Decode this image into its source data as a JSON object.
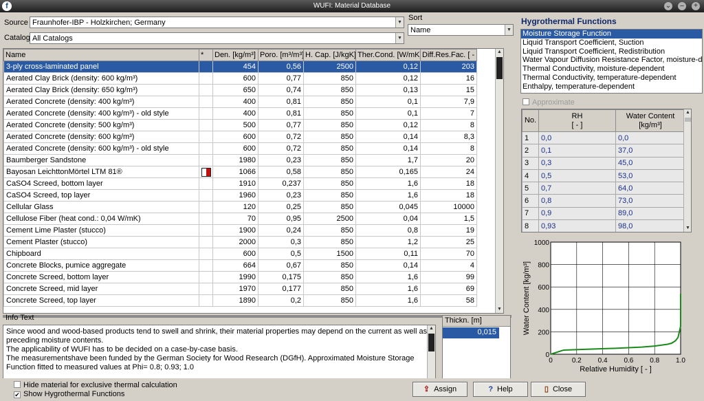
{
  "window": {
    "title": "WUFI: Material Database"
  },
  "source": {
    "label": "Source",
    "value": "Fraunhofer-IBP - Holzkirchen; Germany"
  },
  "catalog": {
    "label": "Catalog",
    "value": "All Catalogs"
  },
  "sort": {
    "label": "Sort",
    "value": "Name"
  },
  "materials": {
    "columns": [
      "Name",
      "*",
      "Den. [kg/m³]",
      "Poro. [m³/m³]",
      "H. Cap. [J/kgK]",
      "Ther.Cond. [W/mK]",
      "Diff.Res.Fac. [ - ]"
    ],
    "rows": [
      [
        "3-ply cross-laminated panel",
        "",
        "454",
        "0,56",
        "2500",
        "0,12",
        "203"
      ],
      [
        "Aerated Clay Brick (density: 600 kg/m³)",
        "",
        "600",
        "0,77",
        "850",
        "0,12",
        "16"
      ],
      [
        "Aerated Clay Brick (density: 650 kg/m³)",
        "",
        "650",
        "0,74",
        "850",
        "0,13",
        "15"
      ],
      [
        "Aerated Concrete (density: 400 kg/m³)",
        "",
        "400",
        "0,81",
        "850",
        "0,1",
        "7,9"
      ],
      [
        "Aerated Concrete (density: 400 kg/m³) - old style",
        "",
        "400",
        "0,81",
        "850",
        "0,1",
        "7"
      ],
      [
        "Aerated Concrete (density: 500 kg/m³)",
        "",
        "500",
        "0,77",
        "850",
        "0,12",
        "8"
      ],
      [
        "Aerated Concrete (density: 600 kg/m³)",
        "",
        "600",
        "0,72",
        "850",
        "0,14",
        "8,3"
      ],
      [
        "Aerated Concrete (density: 600 kg/m³) - old style",
        "",
        "600",
        "0,72",
        "850",
        "0,14",
        "8"
      ],
      [
        "Baumberger Sandstone",
        "",
        "1980",
        "0,23",
        "850",
        "1,7",
        "20"
      ],
      [
        "Bayosan LeichttonMörtel LTM 81®",
        "logo",
        "1066",
        "0,58",
        "850",
        "0,165",
        "24"
      ],
      [
        "CaSO4 Screed, bottom layer",
        "",
        "1910",
        "0,237",
        "850",
        "1,6",
        "18"
      ],
      [
        "CaSO4 Screed, top layer",
        "",
        "1960",
        "0,23",
        "850",
        "1,6",
        "18"
      ],
      [
        "Cellular Glass",
        "",
        "120",
        "0,25",
        "850",
        "0,045",
        "10000"
      ],
      [
        "Cellulose Fiber (heat cond.: 0,04 W/mK)",
        "",
        "70",
        "0,95",
        "2500",
        "0,04",
        "1,5"
      ],
      [
        "Cement Lime Plaster (stucco)",
        "",
        "1900",
        "0,24",
        "850",
        "0,8",
        "19"
      ],
      [
        "Cement Plaster (stucco)",
        "",
        "2000",
        "0,3",
        "850",
        "1,2",
        "25"
      ],
      [
        "Chipboard",
        "",
        "600",
        "0,5",
        "1500",
        "0,11",
        "70"
      ],
      [
        "Concrete Blocks, pumice aggregate",
        "",
        "664",
        "0,67",
        "850",
        "0,14",
        "4"
      ],
      [
        "Concrete Screed, bottom layer",
        "",
        "1990",
        "0,175",
        "850",
        "1,6",
        "99"
      ],
      [
        "Concrete Screed, mid layer",
        "",
        "1970",
        "0,177",
        "850",
        "1,6",
        "69"
      ],
      [
        "Concrete Screed, top layer",
        "",
        "1890",
        "0,2",
        "850",
        "1,6",
        "58"
      ]
    ]
  },
  "info": {
    "label": "Info Text",
    "text": "Since wood and wood-based products tend to swell and shrink, their material properties may depend on the current as well as preceding moisture contents.\nThe applicability of WUFI has to be decided on a case-by-case basis.\nThe measurementshave been funded by the German Society for Wood Research (DGfH). Approximated Moisture Storage Function fitted to measured values at Phi= 0.8; 0.93; 1.0"
  },
  "thickness": {
    "label": "Thickn. [m]",
    "value": "0,015"
  },
  "hygrothermal": {
    "title": "Hygrothermal Functions",
    "functions": [
      "Moisture Storage Function",
      "Liquid Transport Coefficient, Suction",
      "Liquid Transport Coefficient, Redistribution",
      "Water Vapour Diffusion Resistance Factor, moisture-de",
      "Thermal Conductivity, moisture-dependent",
      "Thermal Conductivity, temperature-dependent",
      "Enthalpy, temperature-dependent"
    ],
    "approximate_label": "Approximate",
    "table": {
      "col_no": "No.",
      "col_rh": "RH",
      "col_rh_unit": "[ - ]",
      "col_wc": "Water Content",
      "col_wc_unit": "[kg/m³]",
      "rows": [
        [
          "1",
          "0,0",
          "0,0"
        ],
        [
          "2",
          "0,1",
          "37,0"
        ],
        [
          "3",
          "0,3",
          "45,0"
        ],
        [
          "4",
          "0,5",
          "53,0"
        ],
        [
          "5",
          "0,7",
          "64,0"
        ],
        [
          "6",
          "0,8",
          "73,0"
        ],
        [
          "7",
          "0,9",
          "89,0"
        ],
        [
          "8",
          "0,93",
          "98,0"
        ]
      ]
    }
  },
  "chart_data": {
    "type": "line",
    "xlabel": "Relative Humidity  [ - ]",
    "ylabel": "Water Content [kg/m³]",
    "xlim": [
      0,
      1
    ],
    "ylim": [
      0,
      1000
    ],
    "x_ticks": [
      "0",
      "0.2",
      "0.4",
      "0.6",
      "0.8",
      "1.0"
    ],
    "y_ticks": [
      "0",
      "200",
      "400",
      "600",
      "800",
      "1000"
    ],
    "grid": true,
    "series": [
      {
        "color": "#1a8a1a",
        "x": [
          0.0,
          0.1,
          0.3,
          0.5,
          0.7,
          0.8,
          0.9,
          0.93,
          0.96,
          0.98,
          0.99,
          1.0,
          1.0
        ],
        "y": [
          0,
          37,
          45,
          53,
          64,
          73,
          89,
          98,
          120,
          150,
          200,
          250,
          540
        ]
      }
    ]
  },
  "options": {
    "hide_label": "Hide material for exclusive thermal calculation",
    "hide_checked": false,
    "show_label": "Show Hygrothermal Functions",
    "show_checked": true
  },
  "buttons": {
    "assign": "Assign",
    "help": "Help",
    "close": "Close"
  }
}
